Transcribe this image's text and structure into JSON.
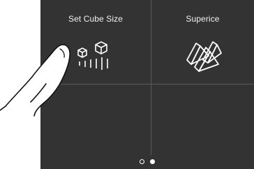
{
  "tiles": {
    "cube_size": {
      "label": "Set Cube Size",
      "icon": "cube-size-icon"
    },
    "superice": {
      "label": "Superice",
      "icon": "superice-icon"
    }
  },
  "pagination": {
    "total_pages": 2,
    "current_page": 2
  },
  "colors": {
    "panel": "#333333",
    "divider": "#5a5a5a",
    "text": "#f2f2f2",
    "background": "#ffffff"
  },
  "overlay": {
    "icon": "tapping-finger-icon"
  }
}
